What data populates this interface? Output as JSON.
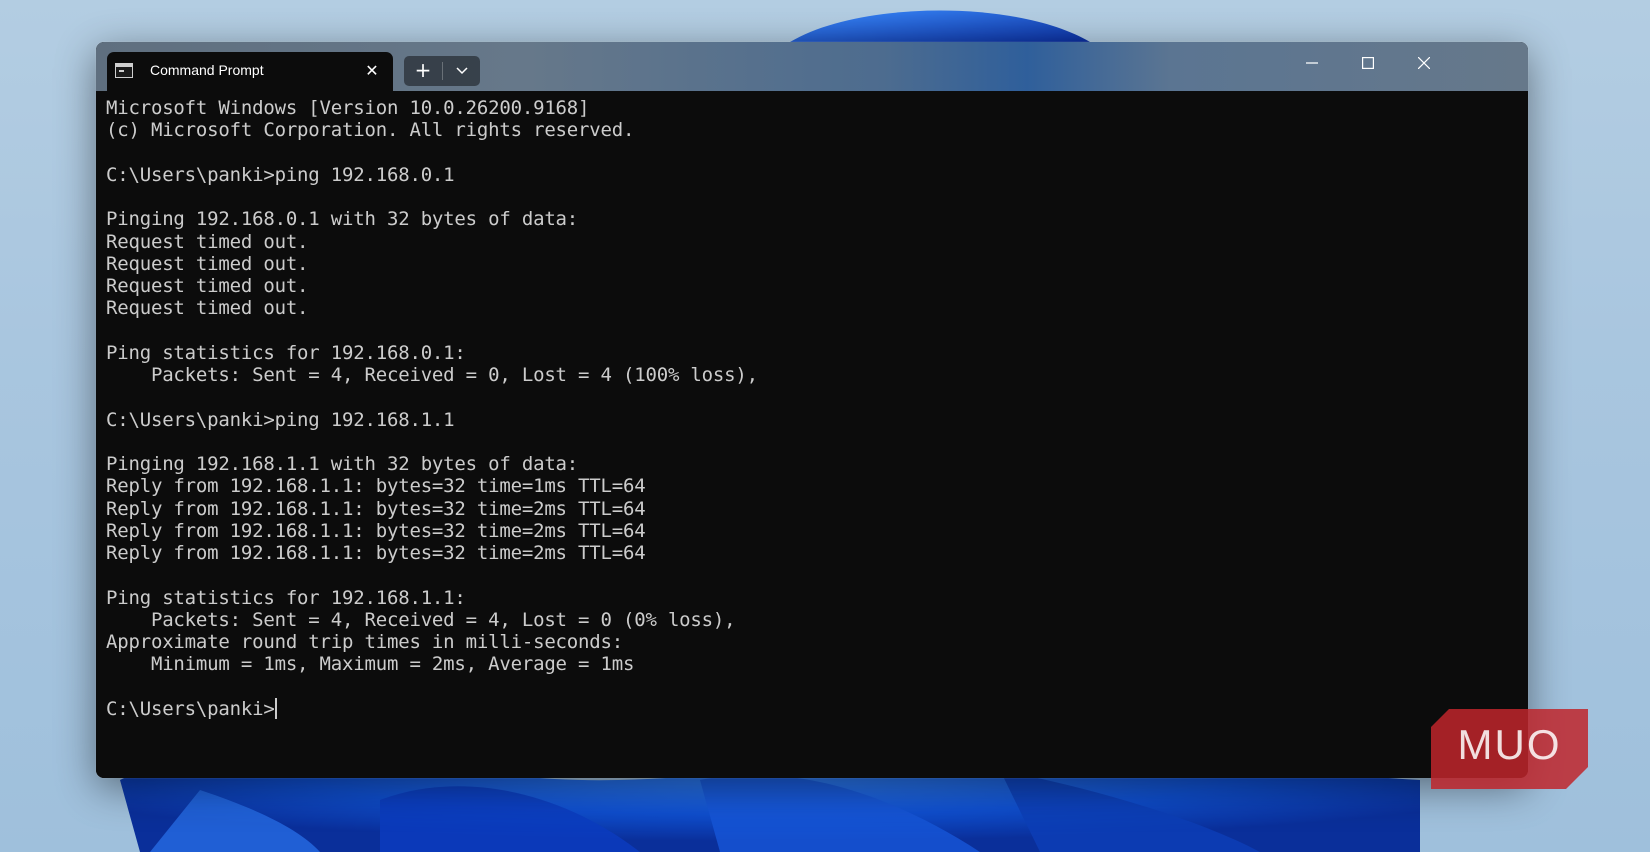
{
  "window": {
    "tab_title": "Command Prompt",
    "tab_close_symbol": "✕",
    "new_tab_symbol": "+",
    "dropdown_icon": "chevron-down-icon",
    "minimize_icon": "minimize-icon",
    "maximize_icon": "maximize-icon",
    "close_icon": "close-icon"
  },
  "console": {
    "lines": [
      "Microsoft Windows [Version 10.0.26200.9168]",
      "(c) Microsoft Corporation. All rights reserved.",
      "",
      "C:\\Users\\panki>ping 192.168.0.1",
      "",
      "Pinging 192.168.0.1 with 32 bytes of data:",
      "Request timed out.",
      "Request timed out.",
      "Request timed out.",
      "Request timed out.",
      "",
      "Ping statistics for 192.168.0.1:",
      "    Packets: Sent = 4, Received = 0, Lost = 4 (100% loss),",
      "",
      "C:\\Users\\panki>ping 192.168.1.1",
      "",
      "Pinging 192.168.1.1 with 32 bytes of data:",
      "Reply from 192.168.1.1: bytes=32 time=1ms TTL=64",
      "Reply from 192.168.1.1: bytes=32 time=2ms TTL=64",
      "Reply from 192.168.1.1: bytes=32 time=2ms TTL=64",
      "Reply from 192.168.1.1: bytes=32 time=2ms TTL=64",
      "",
      "Ping statistics for 192.168.1.1:",
      "    Packets: Sent = 4, Received = 4, Lost = 0 (0% loss),",
      "Approximate round trip times in milli-seconds:",
      "    Minimum = 1ms, Maximum = 2ms, Average = 1ms",
      ""
    ],
    "prompt": "C:\\Users\\panki>",
    "colors": {
      "background": "#0c0c0c",
      "foreground": "#cccccc"
    }
  },
  "watermark": {
    "text": "MUO",
    "color": "#c0262b"
  }
}
